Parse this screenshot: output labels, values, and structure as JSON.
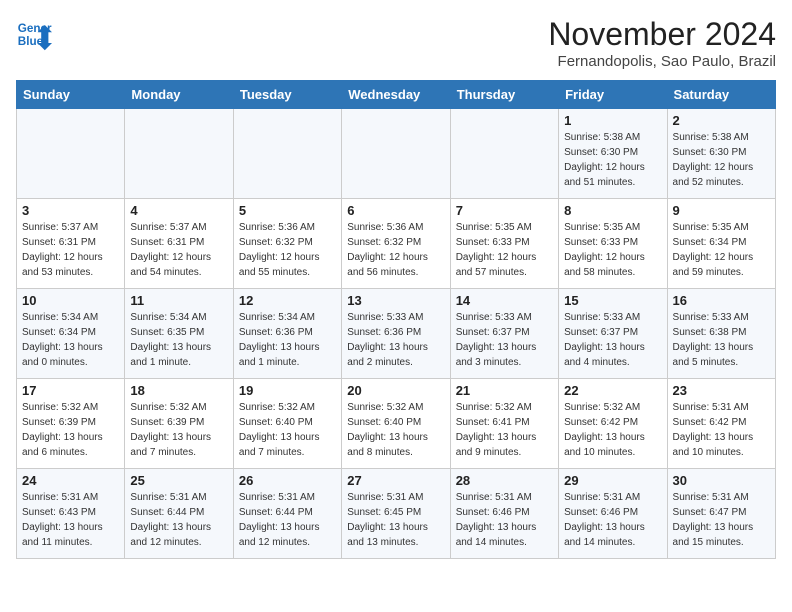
{
  "header": {
    "logo_general": "General",
    "logo_blue": "Blue",
    "month": "November 2024",
    "location": "Fernandopolis, Sao Paulo, Brazil"
  },
  "weekdays": [
    "Sunday",
    "Monday",
    "Tuesday",
    "Wednesday",
    "Thursday",
    "Friday",
    "Saturday"
  ],
  "weeks": [
    [
      {
        "day": "",
        "info": ""
      },
      {
        "day": "",
        "info": ""
      },
      {
        "day": "",
        "info": ""
      },
      {
        "day": "",
        "info": ""
      },
      {
        "day": "",
        "info": ""
      },
      {
        "day": "1",
        "info": "Sunrise: 5:38 AM\nSunset: 6:30 PM\nDaylight: 12 hours and 51 minutes."
      },
      {
        "day": "2",
        "info": "Sunrise: 5:38 AM\nSunset: 6:30 PM\nDaylight: 12 hours and 52 minutes."
      }
    ],
    [
      {
        "day": "3",
        "info": "Sunrise: 5:37 AM\nSunset: 6:31 PM\nDaylight: 12 hours and 53 minutes."
      },
      {
        "day": "4",
        "info": "Sunrise: 5:37 AM\nSunset: 6:31 PM\nDaylight: 12 hours and 54 minutes."
      },
      {
        "day": "5",
        "info": "Sunrise: 5:36 AM\nSunset: 6:32 PM\nDaylight: 12 hours and 55 minutes."
      },
      {
        "day": "6",
        "info": "Sunrise: 5:36 AM\nSunset: 6:32 PM\nDaylight: 12 hours and 56 minutes."
      },
      {
        "day": "7",
        "info": "Sunrise: 5:35 AM\nSunset: 6:33 PM\nDaylight: 12 hours and 57 minutes."
      },
      {
        "day": "8",
        "info": "Sunrise: 5:35 AM\nSunset: 6:33 PM\nDaylight: 12 hours and 58 minutes."
      },
      {
        "day": "9",
        "info": "Sunrise: 5:35 AM\nSunset: 6:34 PM\nDaylight: 12 hours and 59 minutes."
      }
    ],
    [
      {
        "day": "10",
        "info": "Sunrise: 5:34 AM\nSunset: 6:34 PM\nDaylight: 13 hours and 0 minutes."
      },
      {
        "day": "11",
        "info": "Sunrise: 5:34 AM\nSunset: 6:35 PM\nDaylight: 13 hours and 1 minute."
      },
      {
        "day": "12",
        "info": "Sunrise: 5:34 AM\nSunset: 6:36 PM\nDaylight: 13 hours and 1 minute."
      },
      {
        "day": "13",
        "info": "Sunrise: 5:33 AM\nSunset: 6:36 PM\nDaylight: 13 hours and 2 minutes."
      },
      {
        "day": "14",
        "info": "Sunrise: 5:33 AM\nSunset: 6:37 PM\nDaylight: 13 hours and 3 minutes."
      },
      {
        "day": "15",
        "info": "Sunrise: 5:33 AM\nSunset: 6:37 PM\nDaylight: 13 hours and 4 minutes."
      },
      {
        "day": "16",
        "info": "Sunrise: 5:33 AM\nSunset: 6:38 PM\nDaylight: 13 hours and 5 minutes."
      }
    ],
    [
      {
        "day": "17",
        "info": "Sunrise: 5:32 AM\nSunset: 6:39 PM\nDaylight: 13 hours and 6 minutes."
      },
      {
        "day": "18",
        "info": "Sunrise: 5:32 AM\nSunset: 6:39 PM\nDaylight: 13 hours and 7 minutes."
      },
      {
        "day": "19",
        "info": "Sunrise: 5:32 AM\nSunset: 6:40 PM\nDaylight: 13 hours and 7 minutes."
      },
      {
        "day": "20",
        "info": "Sunrise: 5:32 AM\nSunset: 6:40 PM\nDaylight: 13 hours and 8 minutes."
      },
      {
        "day": "21",
        "info": "Sunrise: 5:32 AM\nSunset: 6:41 PM\nDaylight: 13 hours and 9 minutes."
      },
      {
        "day": "22",
        "info": "Sunrise: 5:32 AM\nSunset: 6:42 PM\nDaylight: 13 hours and 10 minutes."
      },
      {
        "day": "23",
        "info": "Sunrise: 5:31 AM\nSunset: 6:42 PM\nDaylight: 13 hours and 10 minutes."
      }
    ],
    [
      {
        "day": "24",
        "info": "Sunrise: 5:31 AM\nSunset: 6:43 PM\nDaylight: 13 hours and 11 minutes."
      },
      {
        "day": "25",
        "info": "Sunrise: 5:31 AM\nSunset: 6:44 PM\nDaylight: 13 hours and 12 minutes."
      },
      {
        "day": "26",
        "info": "Sunrise: 5:31 AM\nSunset: 6:44 PM\nDaylight: 13 hours and 12 minutes."
      },
      {
        "day": "27",
        "info": "Sunrise: 5:31 AM\nSunset: 6:45 PM\nDaylight: 13 hours and 13 minutes."
      },
      {
        "day": "28",
        "info": "Sunrise: 5:31 AM\nSunset: 6:46 PM\nDaylight: 13 hours and 14 minutes."
      },
      {
        "day": "29",
        "info": "Sunrise: 5:31 AM\nSunset: 6:46 PM\nDaylight: 13 hours and 14 minutes."
      },
      {
        "day": "30",
        "info": "Sunrise: 5:31 AM\nSunset: 6:47 PM\nDaylight: 13 hours and 15 minutes."
      }
    ]
  ]
}
